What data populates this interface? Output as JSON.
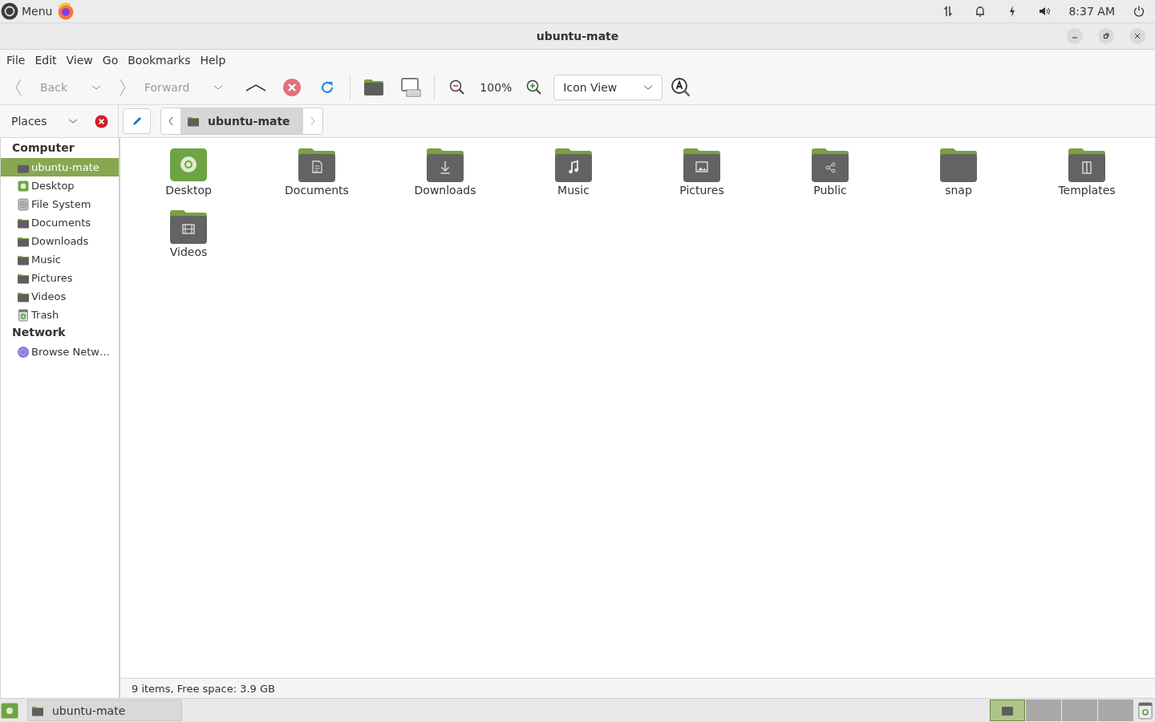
{
  "top_panel": {
    "menu_label": "Menu",
    "clock": "8:37 AM"
  },
  "window": {
    "title": "ubuntu-mate"
  },
  "menubar": [
    "File",
    "Edit",
    "View",
    "Go",
    "Bookmarks",
    "Help"
  ],
  "toolbar": {
    "back": {
      "label": "Back",
      "disabled": true
    },
    "forward": {
      "label": "Forward",
      "disabled": true
    },
    "zoom": "100%",
    "view_mode": "Icon View"
  },
  "side_pane": {
    "title": "Places"
  },
  "location": {
    "path": [
      "ubuntu-mate"
    ]
  },
  "sidebar": {
    "sections": [
      {
        "title": "Computer",
        "items": [
          {
            "label": "ubuntu-mate",
            "kind": "folder",
            "selected": true
          },
          {
            "label": "Desktop",
            "kind": "desktop",
            "selected": false
          },
          {
            "label": "File System",
            "kind": "drive",
            "selected": false
          },
          {
            "label": "Documents",
            "kind": "folder",
            "selected": false
          },
          {
            "label": "Downloads",
            "kind": "folder",
            "selected": false
          },
          {
            "label": "Music",
            "kind": "folder",
            "selected": false
          },
          {
            "label": "Pictures",
            "kind": "folder",
            "selected": false
          },
          {
            "label": "Videos",
            "kind": "folder",
            "selected": false
          },
          {
            "label": "Trash",
            "kind": "trash",
            "selected": false
          }
        ]
      },
      {
        "title": "Network",
        "items": [
          {
            "label": "Browse Netw…",
            "kind": "network",
            "selected": false
          }
        ]
      }
    ]
  },
  "files": [
    {
      "name": "Desktop",
      "kind": "desktop"
    },
    {
      "name": "Documents",
      "kind": "documents"
    },
    {
      "name": "Downloads",
      "kind": "downloads"
    },
    {
      "name": "Music",
      "kind": "music"
    },
    {
      "name": "Pictures",
      "kind": "pictures"
    },
    {
      "name": "Public",
      "kind": "public"
    },
    {
      "name": "snap",
      "kind": "plain"
    },
    {
      "name": "Templates",
      "kind": "templates"
    },
    {
      "name": "Videos",
      "kind": "videos"
    }
  ],
  "status_bar": "9 items, Free space: 3.9 GB",
  "taskbar": {
    "windows": [
      {
        "label": "ubuntu-mate"
      }
    ],
    "workspaces": [
      {
        "selected": true
      },
      {
        "selected": false
      },
      {
        "selected": false
      },
      {
        "selected": false
      }
    ]
  }
}
